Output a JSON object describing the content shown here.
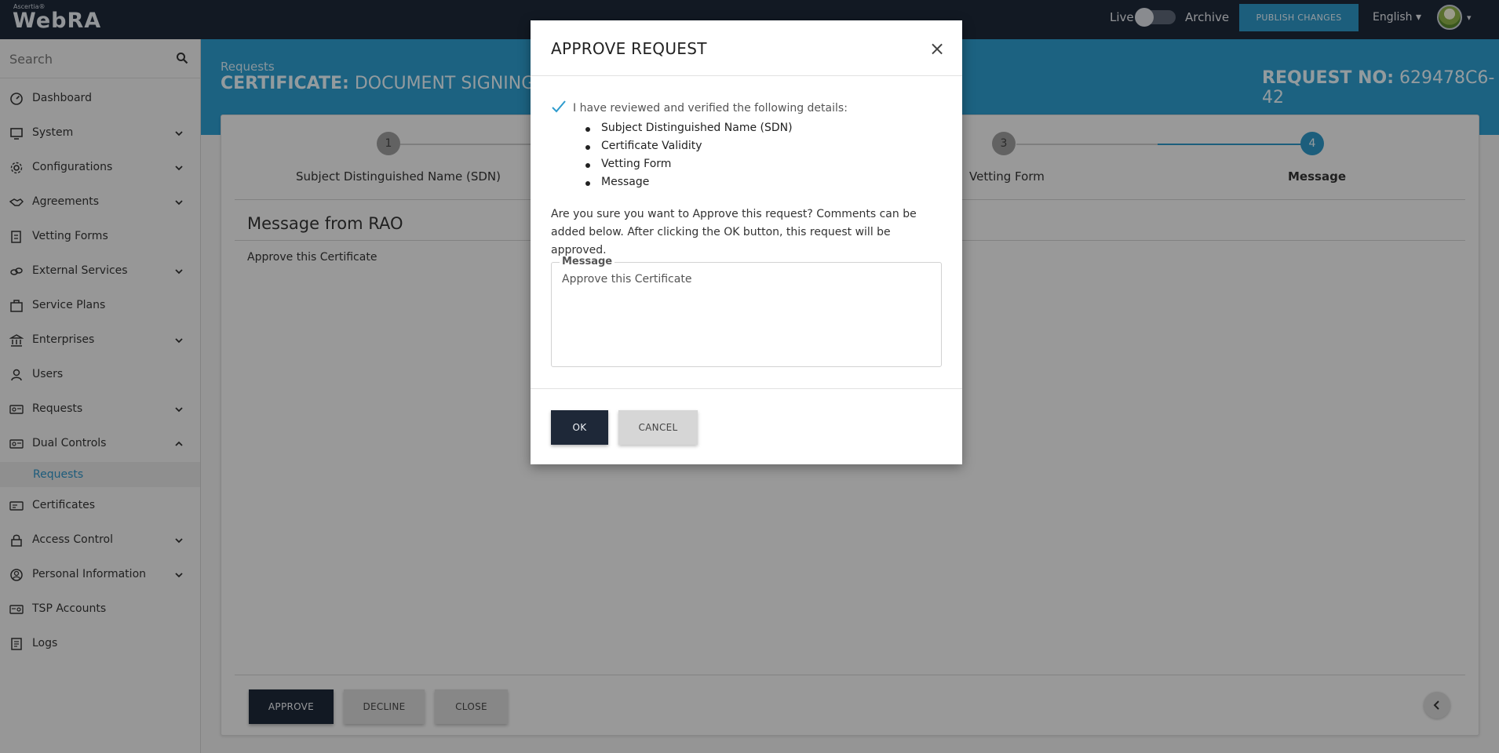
{
  "app": {
    "vendor": "Ascertia®",
    "name": "WebRA"
  },
  "topbar": {
    "live_label": "Live",
    "archive_label": "Archive",
    "publish_label": "PUBLISH CHANGES",
    "language": "English ▾",
    "avatar_caret": "▾"
  },
  "sidebar": {
    "search_placeholder": "Search",
    "items": [
      {
        "label": "Dashboard",
        "icon": "dashboard-icon",
        "chevron": false
      },
      {
        "label": "System",
        "icon": "system-icon",
        "chevron": true
      },
      {
        "label": "Configurations",
        "icon": "gear-icon",
        "chevron": true
      },
      {
        "label": "Agreements",
        "icon": "handshake-icon",
        "chevron": true
      },
      {
        "label": "Vetting Forms",
        "icon": "form-icon",
        "chevron": false
      },
      {
        "label": "External Services",
        "icon": "link-icon",
        "chevron": true
      },
      {
        "label": "Service Plans",
        "icon": "plans-icon",
        "chevron": false
      },
      {
        "label": "Enterprises",
        "icon": "bank-icon",
        "chevron": true
      },
      {
        "label": "Users",
        "icon": "user-icon",
        "chevron": false
      },
      {
        "label": "Requests",
        "icon": "requests-icon",
        "chevron": true
      },
      {
        "label": "Dual Controls",
        "icon": "dual-controls-icon",
        "chevron": "up"
      },
      {
        "label": "Certificates",
        "icon": "certificate-icon",
        "chevron": false
      },
      {
        "label": "Access Control",
        "icon": "lock-icon",
        "chevron": true
      },
      {
        "label": "Personal Information",
        "icon": "person-circle-icon",
        "chevron": true
      },
      {
        "label": "TSP Accounts",
        "icon": "tsp-icon",
        "chevron": false
      },
      {
        "label": "Logs",
        "icon": "logs-icon",
        "chevron": false
      }
    ],
    "sub_item": "Requests"
  },
  "header": {
    "breadcrumb": "Requests",
    "cert_prefix": "CERTIFICATE:",
    "cert_type": "DOCUMENT SIGNING",
    "req_prefix": "REQUEST NO:",
    "req_number": "629478C6-42"
  },
  "stepper": {
    "steps": [
      {
        "number": "1",
        "label": "Subject Distinguished Name (SDN)",
        "active": false
      },
      {
        "number": "3",
        "label": "Vetting Form",
        "active": false
      },
      {
        "number": "4",
        "label": "Message",
        "active": true
      }
    ]
  },
  "content": {
    "message_title": "Message from RAO",
    "message_body": "Approve this Certificate"
  },
  "actions": {
    "approve": "APPROVE",
    "decline": "DECLINE",
    "close": "CLOSE"
  },
  "modal": {
    "title": "APPROVE REQUEST",
    "close_symbol": "×",
    "verify_text": "I have reviewed and verified the following details:",
    "details": [
      "Subject Distinguished Name (SDN)",
      "Certificate Validity",
      "Vetting Form",
      "Message"
    ],
    "confirm_text": "Are you sure you want to Approve this request? Comments can be added below. After clicking the OK button, this request will be approved.",
    "message_legend": "Message",
    "message_value": "Approve this Certificate",
    "ok_label": "OK",
    "cancel_label": "CANCEL"
  },
  "colors": {
    "topbar": "#1e2838",
    "accent": "#2d9bcd",
    "dark_button": "#1e2838"
  }
}
